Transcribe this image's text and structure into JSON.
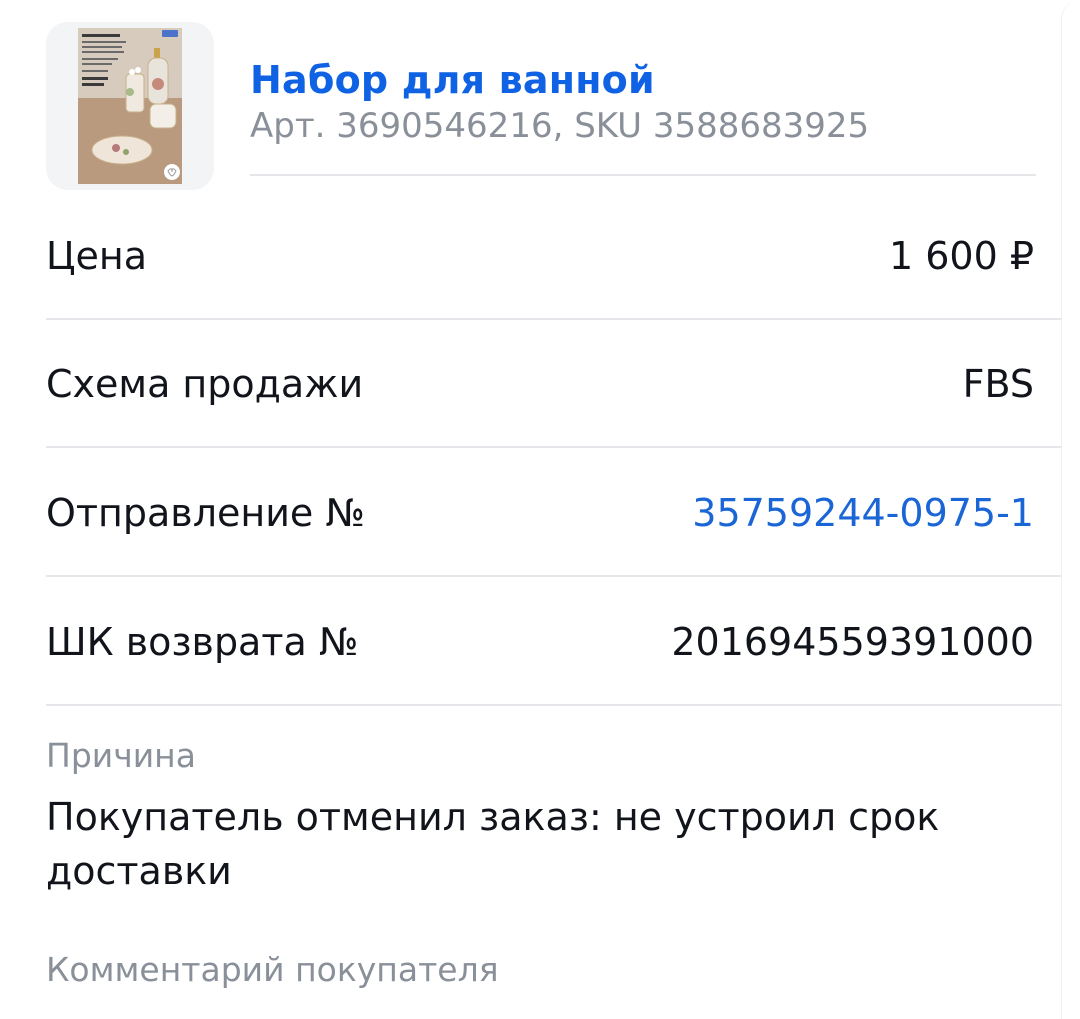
{
  "product": {
    "title": "Набор для ванной",
    "subtitle": "Арт. 3690546216, SKU 3588683925",
    "image_icon": "product-photo-bath-set"
  },
  "rows": [
    {
      "label": "Цена",
      "value": "1 600 ₽"
    },
    {
      "label": "Схема продажи",
      "value": "FBS"
    },
    {
      "label": "Отправление №",
      "value": "35759244-0975-1"
    },
    {
      "label": "ШК возврата №",
      "value": "201694559391000"
    }
  ],
  "reason": {
    "caption": "Причина",
    "text": "Покупатель отменил заказ: не устроил срок доставки"
  },
  "comment": {
    "caption": "Комментарий покупателя"
  },
  "colors": {
    "accent": "#0f62e3",
    "link": "#1a66d6",
    "muted": "#8a9099",
    "divider": "#e4e6ea"
  }
}
